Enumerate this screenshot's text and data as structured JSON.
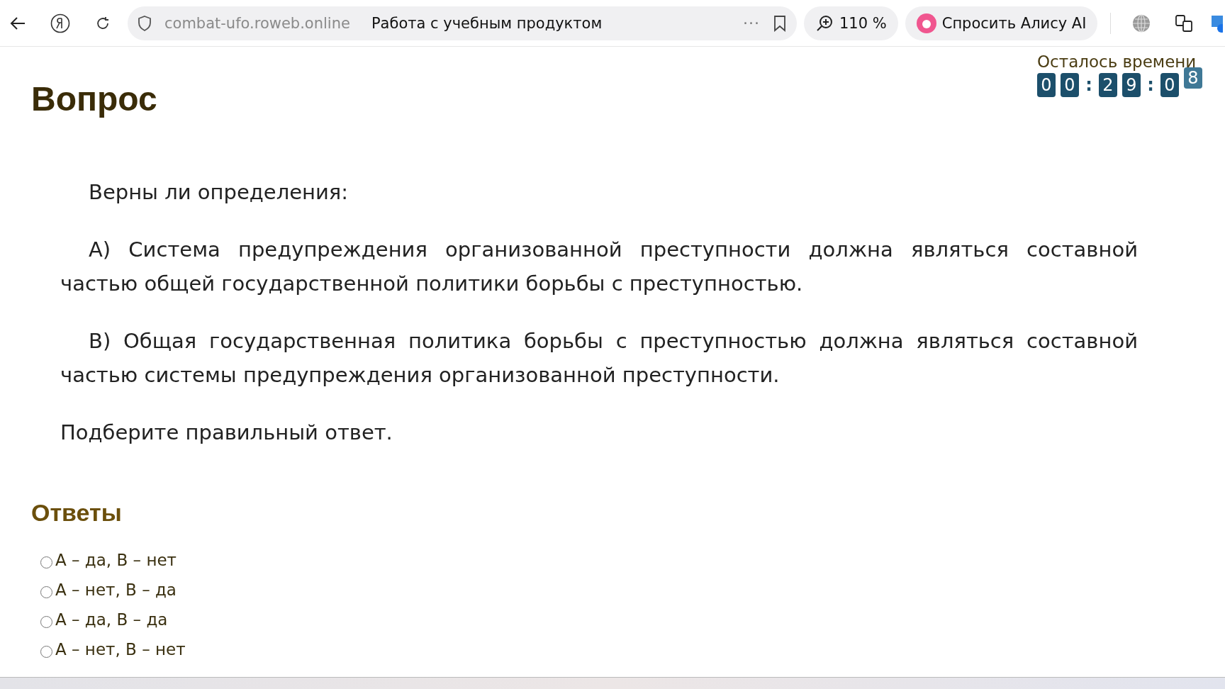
{
  "browser": {
    "url": "combat-ufo.roweb.online",
    "page_title": "Работа с учебным продуктом",
    "menu": "···",
    "zoom": "110 %",
    "assistant": "Спросить Алису AI"
  },
  "timer": {
    "label": "Осталось времени",
    "digits": [
      {
        "text": "0",
        "kind": "digit"
      },
      {
        "text": "0",
        "kind": "digit"
      },
      {
        "text": ":",
        "kind": "colon"
      },
      {
        "text": "2",
        "kind": "digit"
      },
      {
        "text": "9",
        "kind": "digit"
      },
      {
        "text": ":",
        "kind": "colon"
      },
      {
        "text": "0",
        "kind": "digit"
      },
      {
        "text": "8",
        "kind": "flipping"
      }
    ]
  },
  "question": {
    "heading": "Вопрос",
    "paragraphs": [
      {
        "text": "Верны ли определения:",
        "kind": "indented"
      },
      {
        "text": "А) Система предупреждения организованной преступности должна являться составной частью общей государственной политики борьбы с преступностью.",
        "kind": "indented"
      },
      {
        "text": "В) Общая государственная политика борьбы с преступностью должна являться составной частью системы предупреждения организованной преступности.",
        "kind": "indented"
      },
      {
        "text": "Подберите правильный ответ.",
        "kind": "plain"
      }
    ]
  },
  "answers": {
    "heading": "Ответы",
    "options": [
      {
        "label": "А – да, В – нет",
        "selected": false
      },
      {
        "label": "А – нет, В – да",
        "selected": false
      },
      {
        "label": "А – да, В – да",
        "selected": false
      },
      {
        "label": "А – нет, В – нет",
        "selected": false
      }
    ]
  }
}
